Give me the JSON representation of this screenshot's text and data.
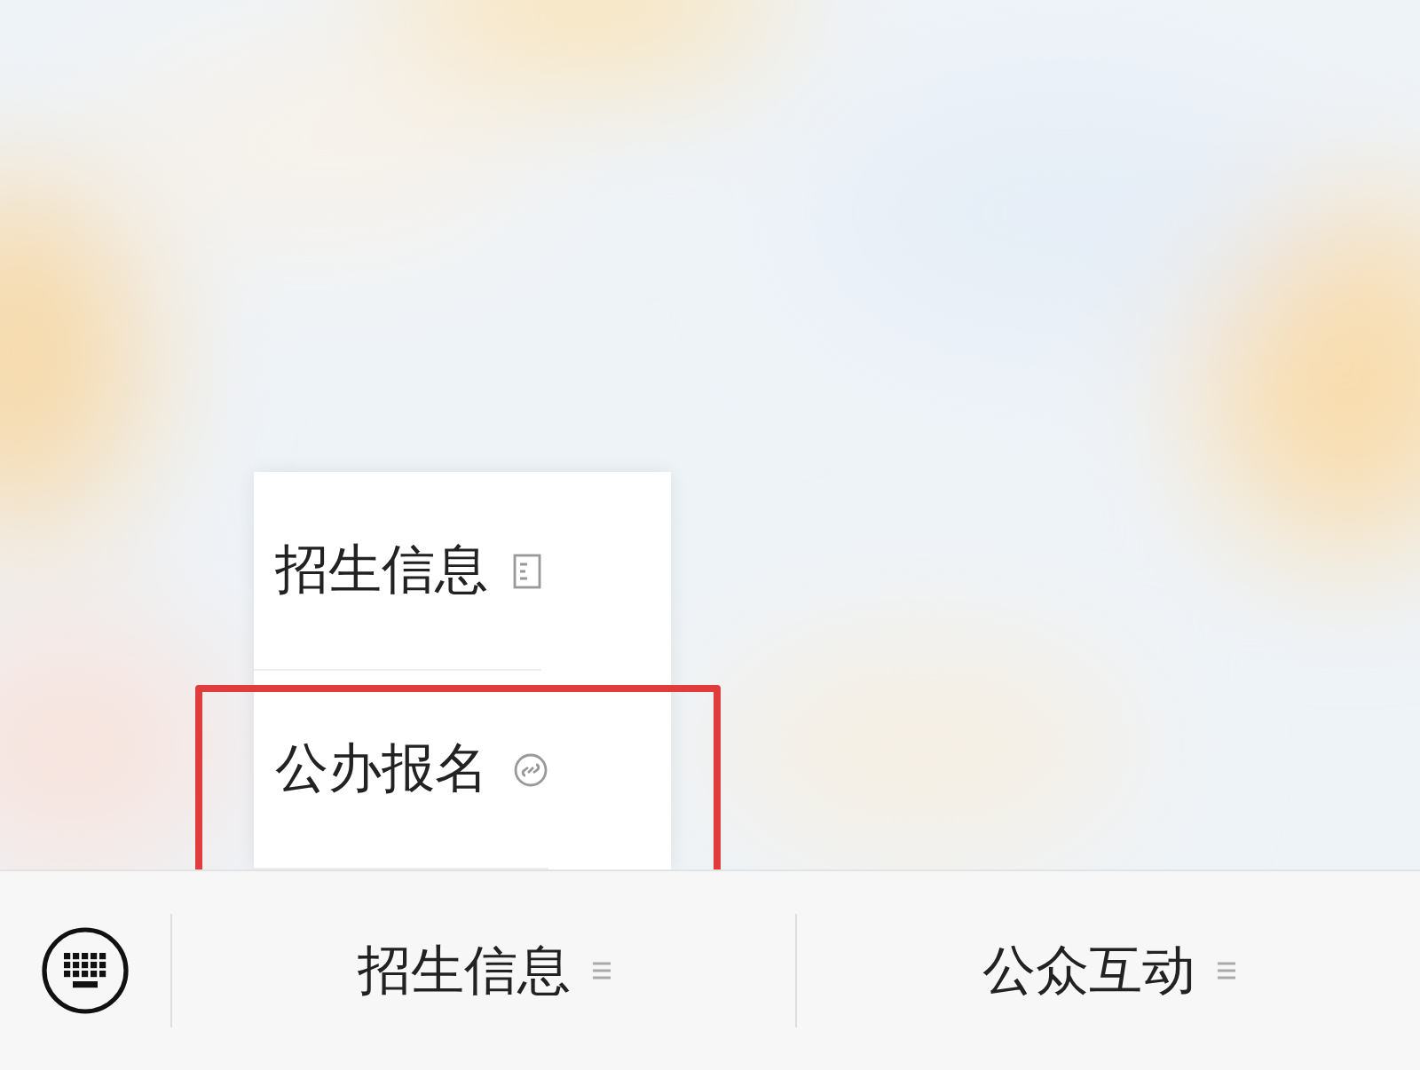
{
  "menu_bar": {
    "buttons": [
      {
        "label": "招生信息",
        "submenu": [
          {
            "label": "招生信息",
            "kind": "page",
            "highlighted": false
          },
          {
            "label": "公办报名",
            "kind": "mini-program",
            "highlighted": true
          }
        ]
      },
      {
        "label": "公众互动"
      }
    ]
  }
}
